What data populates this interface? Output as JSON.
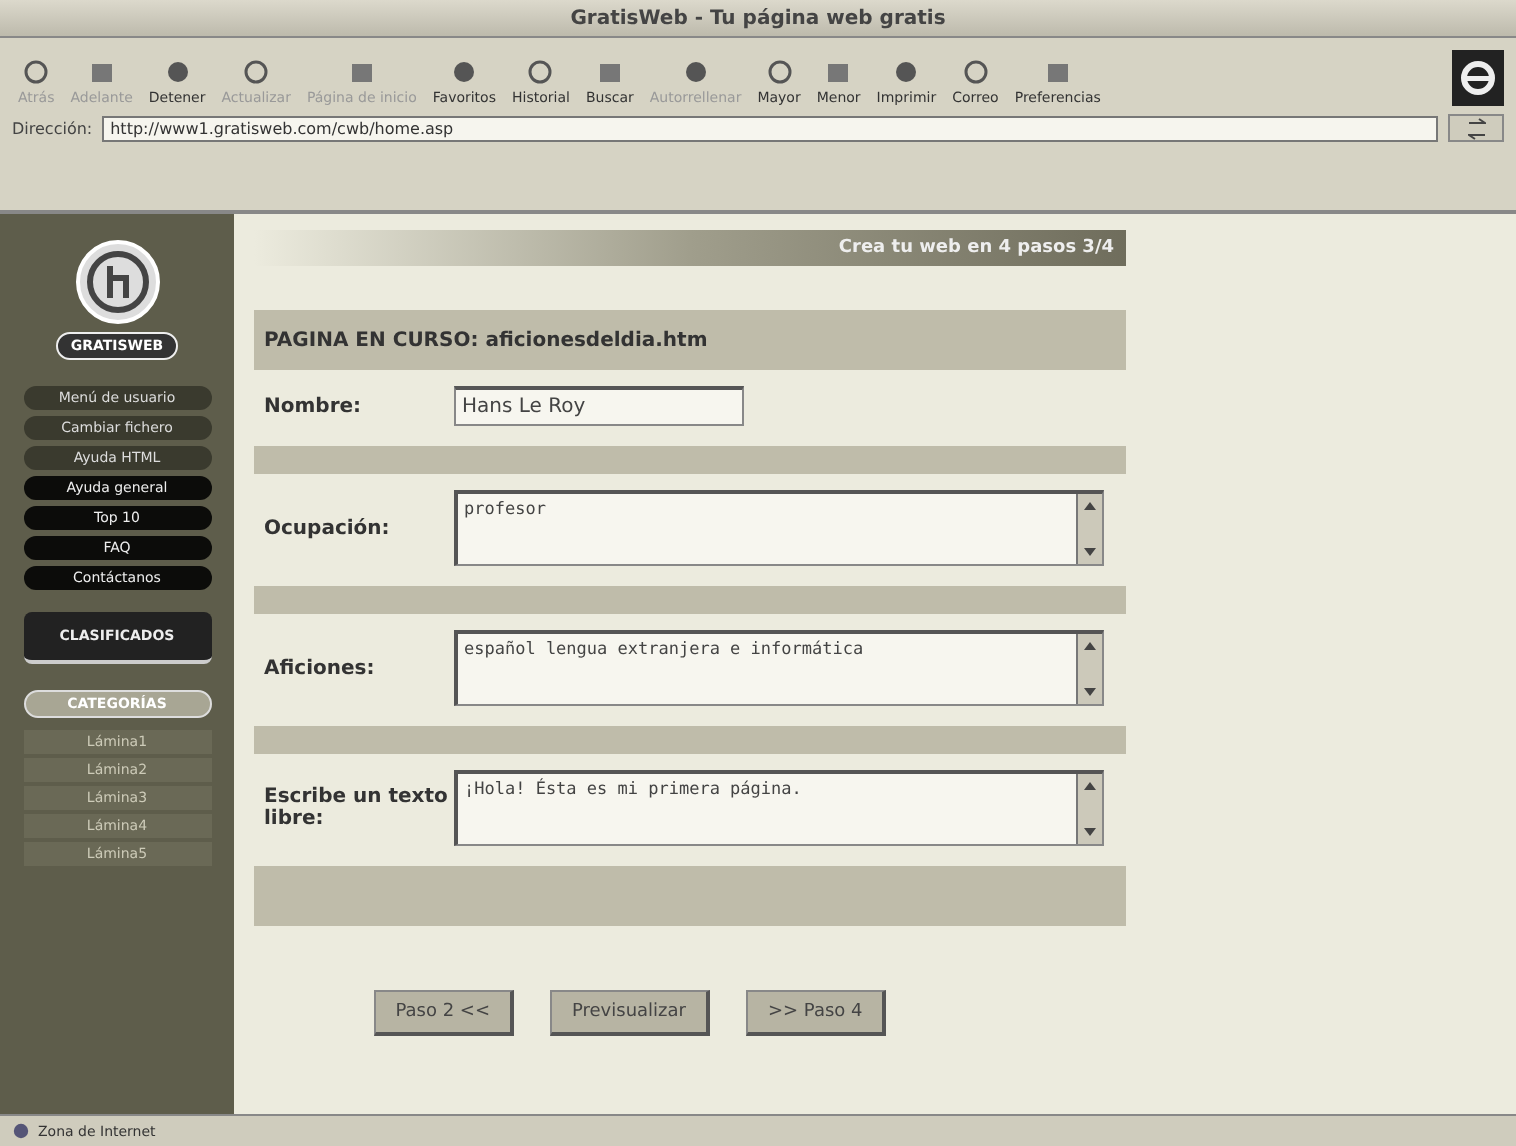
{
  "window": {
    "title": "GratisWeb - Tu página web gratis"
  },
  "toolbar": [
    {
      "label": "Atrás",
      "disabled": true
    },
    {
      "label": "Adelante",
      "disabled": true
    },
    {
      "label": "Detener",
      "disabled": false
    },
    {
      "label": "Actualizar",
      "disabled": true
    },
    {
      "label": "Página de inicio",
      "disabled": true
    },
    {
      "label": "Favoritos",
      "disabled": false
    },
    {
      "label": "Historial",
      "disabled": false
    },
    {
      "label": "Buscar",
      "disabled": false
    },
    {
      "label": "Autorrellenar",
      "disabled": true
    },
    {
      "label": "Mayor",
      "disabled": false
    },
    {
      "label": "Menor",
      "disabled": false
    },
    {
      "label": "Imprimir",
      "disabled": false
    },
    {
      "label": "Correo",
      "disabled": false
    },
    {
      "label": "Preferencias",
      "disabled": false
    }
  ],
  "address": {
    "label": "Dirección:",
    "value": "http://www1.gratisweb.com/cwb/home.asp"
  },
  "sidebar": {
    "logo": "GRATISWEB",
    "items": [
      {
        "label": "Menú de usuario",
        "kind": "plain"
      },
      {
        "label": "Cambiar fichero",
        "kind": "plain"
      },
      {
        "label": "Ayuda HTML",
        "kind": "plain"
      },
      {
        "label": "Ayuda general",
        "kind": "dark"
      },
      {
        "label": "Top 10",
        "kind": "dark"
      },
      {
        "label": "FAQ",
        "kind": "dark"
      },
      {
        "label": "Contáctanos",
        "kind": "dark"
      },
      {
        "label": "CLASIFICADOS",
        "kind": "banner"
      },
      {
        "label": "CATEGORÍAS",
        "kind": "pill"
      },
      {
        "label": "Lámina1",
        "kind": "link"
      },
      {
        "label": "Lámina2",
        "kind": "link"
      },
      {
        "label": "Lámina3",
        "kind": "link"
      },
      {
        "label": "Lámina4",
        "kind": "link"
      },
      {
        "label": "Lámina5",
        "kind": "link"
      }
    ]
  },
  "banner": "Crea tu web en 4 pasos 3/4",
  "page_heading": "PAGINA EN CURSO: aficionesdeldia.htm",
  "fields": [
    {
      "label": "Nombre:",
      "value": "Hans Le Roy",
      "kind": "input"
    },
    {
      "label": "Ocupación:",
      "value": "profesor",
      "kind": "textarea"
    },
    {
      "label": "Aficiones:",
      "value": "español lengua extranjera e informática",
      "kind": "textarea"
    },
    {
      "label": "Escribe un texto libre:",
      "value": "¡Hola! Ésta es mi primera página.",
      "kind": "textarea"
    }
  ],
  "buttons": [
    "Paso 2 <<",
    "Previsualizar",
    ">> Paso 4"
  ],
  "status_bar": "Zona de Internet"
}
